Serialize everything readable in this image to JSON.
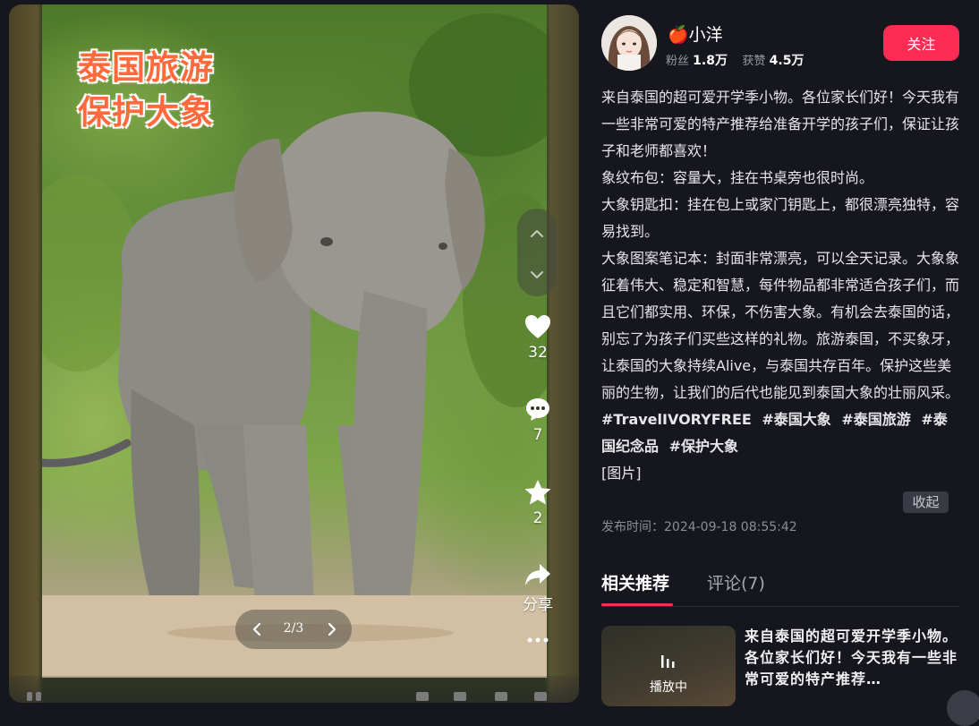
{
  "media": {
    "photo_title_line1": "泰国旅游",
    "photo_title_line2": "保护大象",
    "pager": "2/3",
    "actions": {
      "like_count": "32",
      "comment_count": "7",
      "favorite_count": "2",
      "share_label": "分享"
    }
  },
  "author": {
    "name": "🍎小洋",
    "fans_label": "粉丝",
    "fans_value": "1.8万",
    "likes_label": "获赞",
    "likes_value": "4.5万",
    "follow_label": "关注"
  },
  "post": {
    "paragraphs": [
      "来自泰国的超可爱开学季小物。各位家长们好！今天我有一些非常可爱的特产推荐给准备开学的孩子们，保证让孩子和老师都喜欢！",
      "象纹布包：容量大，挂在书桌旁也很时尚。",
      "大象钥匙扣：挂在包上或家门钥匙上，都很漂亮独特，容易找到。",
      "大象图案笔记本：封面非常漂亮，可以全天记录。大象象征着伟大、稳定和智慧，每件物品都非常适合孩子们，而且它们都实用、环保，不伤害大象。有机会去泰国的话，别忘了为孩子们买些这样的礼物。旅游泰国，不买象牙，让泰国的大象持续Alive，与泰国共存百年。保护这些美丽的生物，让我们的后代也能见到泰国大象的壮丽风采。"
    ],
    "hashtags": [
      "#TravelIVORYFREE",
      "#泰国大象",
      "#泰国旅游",
      "#泰国纪念品",
      "#保护大象"
    ],
    "picture_label": "[图片]",
    "collapse_label": "收起",
    "publish_time": "发布时间：2024-09-18 08:55:42"
  },
  "tabs": [
    {
      "label": "相关推荐",
      "active": true
    },
    {
      "label": "评论(7)",
      "active": false
    }
  ],
  "recommendation": {
    "playing_label": "播放中",
    "title": "来自泰国的超可爱开学季小物。各位家长们好！今天我有一些非常可爱的特产推荐…"
  },
  "colors": {
    "accent": "#fe2c55",
    "background": "#16161e",
    "title_orange": "#ff6a3d"
  }
}
